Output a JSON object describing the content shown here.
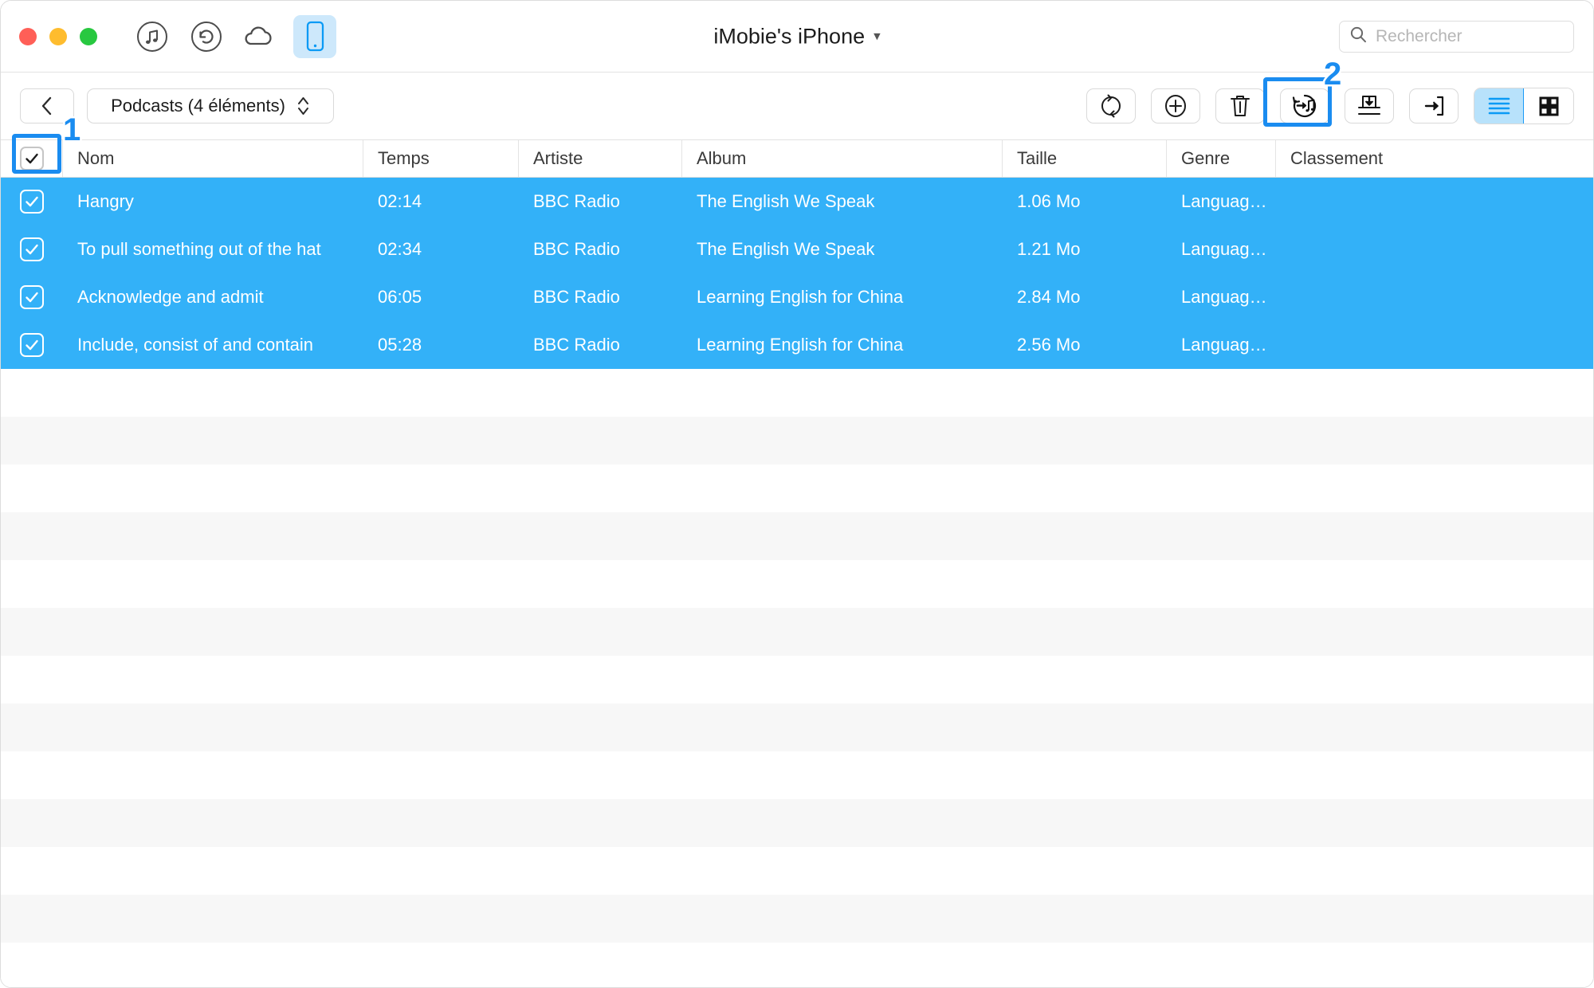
{
  "window": {
    "title": "iMobie's iPhone",
    "title_chevron": "chevron-down",
    "traffic_lights": [
      "close",
      "minimize",
      "zoom"
    ],
    "nav_icons": [
      {
        "name": "music-icon",
        "label": "Music"
      },
      {
        "name": "history-icon",
        "label": "Backup History"
      },
      {
        "name": "cloud-icon",
        "label": "iCloud"
      },
      {
        "name": "device-icon",
        "label": "Device",
        "active": true
      }
    ]
  },
  "search": {
    "placeholder": "Rechercher",
    "value": "",
    "icon": "search-icon"
  },
  "toolbar": {
    "back_label": "‹",
    "path_label": "Podcasts (4 éléments)",
    "path_icon": "up-down-chevron-icon",
    "actions": [
      {
        "name": "refresh-button",
        "icon": "refresh-icon"
      },
      {
        "name": "add-button",
        "icon": "plus-circle-icon"
      },
      {
        "name": "delete-button",
        "icon": "trash-icon"
      },
      {
        "name": "to-itunes-button",
        "icon": "export-to-itunes-icon",
        "highlighted": true
      },
      {
        "name": "to-mac-button",
        "icon": "export-to-mac-icon"
      },
      {
        "name": "to-device-button",
        "icon": "import-to-device-icon"
      }
    ],
    "view_modes": [
      {
        "name": "list-view-toggle",
        "icon": "list-icon",
        "active": true
      },
      {
        "name": "grid-view-toggle",
        "icon": "grid-icon",
        "active": false
      }
    ]
  },
  "annotations": [
    {
      "number": "1",
      "target": "select-all-checkbox"
    },
    {
      "number": "2",
      "target": "to-itunes-button"
    }
  ],
  "table": {
    "select_all_checked": true,
    "columns": [
      "Nom",
      "Temps",
      "Artiste",
      "Album",
      "Taille",
      "Genre",
      "Classement"
    ],
    "rows": [
      {
        "checked": true,
        "nom": "Hangry",
        "temps": "02:14",
        "artiste": "BBC Radio",
        "album": "The English We Speak",
        "taille": "1.06 Mo",
        "genre": "Languag…",
        "classement": ""
      },
      {
        "checked": true,
        "nom": "To pull something out of the hat",
        "temps": "02:34",
        "artiste": "BBC Radio",
        "album": "The English We Speak",
        "taille": "1.21 Mo",
        "genre": "Languag…",
        "classement": ""
      },
      {
        "checked": true,
        "nom": "Acknowledge and admit",
        "temps": "06:05",
        "artiste": "BBC Radio",
        "album": "Learning English for China",
        "taille": "2.84 Mo",
        "genre": "Languag…",
        "classement": ""
      },
      {
        "checked": true,
        "nom": "Include, consist of and contain",
        "temps": "05:28",
        "artiste": "BBC Radio",
        "album": "Learning English for China",
        "taille": "2.56 Mo",
        "genre": "Languag…",
        "classement": ""
      }
    ]
  },
  "colors": {
    "selection_blue": "#33b1f8",
    "accent_blue": "#1a8cf0",
    "toggle_active": "#b8e2fb",
    "stripe_gray": "#f7f7f7"
  }
}
